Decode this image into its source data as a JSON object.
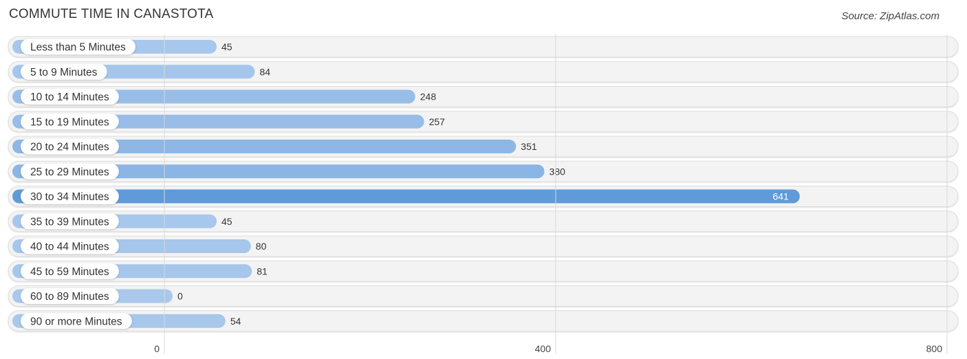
{
  "header": {
    "title": "COMMUTE TIME IN CANASTOTA",
    "source": "Source: ZipAtlas.com"
  },
  "chart_data": {
    "type": "bar",
    "orientation": "horizontal",
    "title": "COMMUTE TIME IN CANASTOTA",
    "xlabel": "",
    "ylabel": "",
    "categories": [
      "Less than 5 Minutes",
      "5 to 9 Minutes",
      "10 to 14 Minutes",
      "15 to 19 Minutes",
      "20 to 24 Minutes",
      "25 to 29 Minutes",
      "30 to 34 Minutes",
      "35 to 39 Minutes",
      "40 to 44 Minutes",
      "45 to 59 Minutes",
      "60 to 89 Minutes",
      "90 or more Minutes"
    ],
    "values": [
      45,
      84,
      248,
      257,
      351,
      380,
      641,
      45,
      80,
      81,
      0,
      54
    ],
    "value_labels": [
      "45",
      "84",
      "248",
      "257",
      "351",
      "380",
      "641",
      "45",
      "80",
      "81",
      "0",
      "54"
    ],
    "xlim": [
      0,
      800
    ],
    "xticks": [
      0,
      400,
      800
    ],
    "xtick_labels": [
      "0",
      "400",
      "800"
    ],
    "grid": true,
    "legend": "none",
    "highlight_index": 6,
    "colors": {
      "bar_light": "#a9c8ec",
      "bar_dark": "#5f9ad9",
      "track": "#f3f3f3",
      "track_border": "#dcdcdc",
      "gridline": "#d8d8d8"
    }
  }
}
